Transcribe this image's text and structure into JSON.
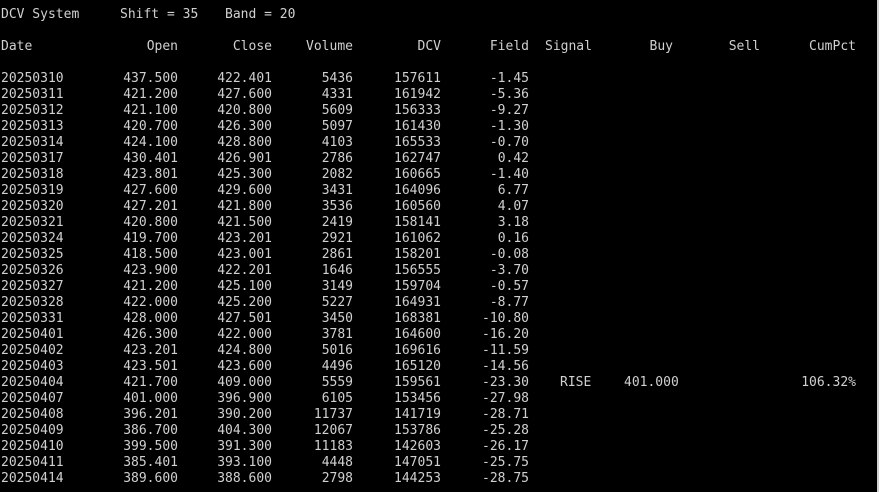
{
  "title": {
    "system": "DCV System",
    "shift": "Shift = 35",
    "band": "Band = 20"
  },
  "columns": {
    "date": "Date",
    "open": "Open",
    "close": "Close",
    "volume": "Volume",
    "dcv": "DCV",
    "field": "Field",
    "signal": "Signal",
    "buy": "Buy",
    "sell": "Sell",
    "cumpct": "CumPct"
  },
  "rows": [
    {
      "date": "20250310",
      "open": "437.500",
      "close": "422.401",
      "volume": "5436",
      "dcv": "157611",
      "field": "-1.45",
      "signal": "",
      "buy": "",
      "sell": "",
      "cumpct": ""
    },
    {
      "date": "20250311",
      "open": "421.200",
      "close": "427.600",
      "volume": "4331",
      "dcv": "161942",
      "field": "-5.36",
      "signal": "",
      "buy": "",
      "sell": "",
      "cumpct": ""
    },
    {
      "date": "20250312",
      "open": "421.100",
      "close": "420.800",
      "volume": "5609",
      "dcv": "156333",
      "field": "-9.27",
      "signal": "",
      "buy": "",
      "sell": "",
      "cumpct": ""
    },
    {
      "date": "20250313",
      "open": "420.700",
      "close": "426.300",
      "volume": "5097",
      "dcv": "161430",
      "field": "-1.30",
      "signal": "",
      "buy": "",
      "sell": "",
      "cumpct": ""
    },
    {
      "date": "20250314",
      "open": "424.100",
      "close": "428.800",
      "volume": "4103",
      "dcv": "165533",
      "field": "-0.70",
      "signal": "",
      "buy": "",
      "sell": "",
      "cumpct": ""
    },
    {
      "date": "20250317",
      "open": "430.401",
      "close": "426.901",
      "volume": "2786",
      "dcv": "162747",
      "field": "0.42",
      "signal": "",
      "buy": "",
      "sell": "",
      "cumpct": ""
    },
    {
      "date": "20250318",
      "open": "423.801",
      "close": "425.300",
      "volume": "2082",
      "dcv": "160665",
      "field": "-1.40",
      "signal": "",
      "buy": "",
      "sell": "",
      "cumpct": ""
    },
    {
      "date": "20250319",
      "open": "427.600",
      "close": "429.600",
      "volume": "3431",
      "dcv": "164096",
      "field": "6.77",
      "signal": "",
      "buy": "",
      "sell": "",
      "cumpct": ""
    },
    {
      "date": "20250320",
      "open": "427.201",
      "close": "421.800",
      "volume": "3536",
      "dcv": "160560",
      "field": "4.07",
      "signal": "",
      "buy": "",
      "sell": "",
      "cumpct": ""
    },
    {
      "date": "20250321",
      "open": "420.800",
      "close": "421.500",
      "volume": "2419",
      "dcv": "158141",
      "field": "3.18",
      "signal": "",
      "buy": "",
      "sell": "",
      "cumpct": ""
    },
    {
      "date": "20250324",
      "open": "419.700",
      "close": "423.201",
      "volume": "2921",
      "dcv": "161062",
      "field": "0.16",
      "signal": "",
      "buy": "",
      "sell": "",
      "cumpct": ""
    },
    {
      "date": "20250325",
      "open": "418.500",
      "close": "423.001",
      "volume": "2861",
      "dcv": "158201",
      "field": "-0.08",
      "signal": "",
      "buy": "",
      "sell": "",
      "cumpct": ""
    },
    {
      "date": "20250326",
      "open": "423.900",
      "close": "422.201",
      "volume": "1646",
      "dcv": "156555",
      "field": "-3.70",
      "signal": "",
      "buy": "",
      "sell": "",
      "cumpct": ""
    },
    {
      "date": "20250327",
      "open": "421.200",
      "close": "425.100",
      "volume": "3149",
      "dcv": "159704",
      "field": "-0.57",
      "signal": "",
      "buy": "",
      "sell": "",
      "cumpct": ""
    },
    {
      "date": "20250328",
      "open": "422.000",
      "close": "425.200",
      "volume": "5227",
      "dcv": "164931",
      "field": "-8.77",
      "signal": "",
      "buy": "",
      "sell": "",
      "cumpct": ""
    },
    {
      "date": "20250331",
      "open": "428.000",
      "close": "427.501",
      "volume": "3450",
      "dcv": "168381",
      "field": "-10.80",
      "signal": "",
      "buy": "",
      "sell": "",
      "cumpct": ""
    },
    {
      "date": "20250401",
      "open": "426.300",
      "close": "422.000",
      "volume": "3781",
      "dcv": "164600",
      "field": "-16.20",
      "signal": "",
      "buy": "",
      "sell": "",
      "cumpct": ""
    },
    {
      "date": "20250402",
      "open": "423.201",
      "close": "424.800",
      "volume": "5016",
      "dcv": "169616",
      "field": "-11.59",
      "signal": "",
      "buy": "",
      "sell": "",
      "cumpct": ""
    },
    {
      "date": "20250403",
      "open": "423.501",
      "close": "423.600",
      "volume": "4496",
      "dcv": "165120",
      "field": "-14.56",
      "signal": "",
      "buy": "",
      "sell": "",
      "cumpct": ""
    },
    {
      "date": "20250404",
      "open": "421.700",
      "close": "409.000",
      "volume": "5559",
      "dcv": "159561",
      "field": "-23.30",
      "signal": "RISE",
      "buy": "401.000",
      "sell": "",
      "cumpct": "106.32%"
    },
    {
      "date": "20250407",
      "open": "401.000",
      "close": "396.900",
      "volume": "6105",
      "dcv": "153456",
      "field": "-27.98",
      "signal": "",
      "buy": "",
      "sell": "",
      "cumpct": ""
    },
    {
      "date": "20250408",
      "open": "396.201",
      "close": "390.200",
      "volume": "11737",
      "dcv": "141719",
      "field": "-28.71",
      "signal": "",
      "buy": "",
      "sell": "",
      "cumpct": ""
    },
    {
      "date": "20250409",
      "open": "386.700",
      "close": "404.300",
      "volume": "12067",
      "dcv": "153786",
      "field": "-25.28",
      "signal": "",
      "buy": "",
      "sell": "",
      "cumpct": ""
    },
    {
      "date": "20250410",
      "open": "399.500",
      "close": "391.300",
      "volume": "11183",
      "dcv": "142603",
      "field": "-26.17",
      "signal": "",
      "buy": "",
      "sell": "",
      "cumpct": ""
    },
    {
      "date": "20250411",
      "open": "385.401",
      "close": "393.100",
      "volume": "4448",
      "dcv": "147051",
      "field": "-25.75",
      "signal": "",
      "buy": "",
      "sell": "",
      "cumpct": ""
    },
    {
      "date": "20250414",
      "open": "389.600",
      "close": "388.600",
      "volume": "2798",
      "dcv": "144253",
      "field": "-28.75",
      "signal": "",
      "buy": "",
      "sell": "",
      "cumpct": ""
    }
  ]
}
